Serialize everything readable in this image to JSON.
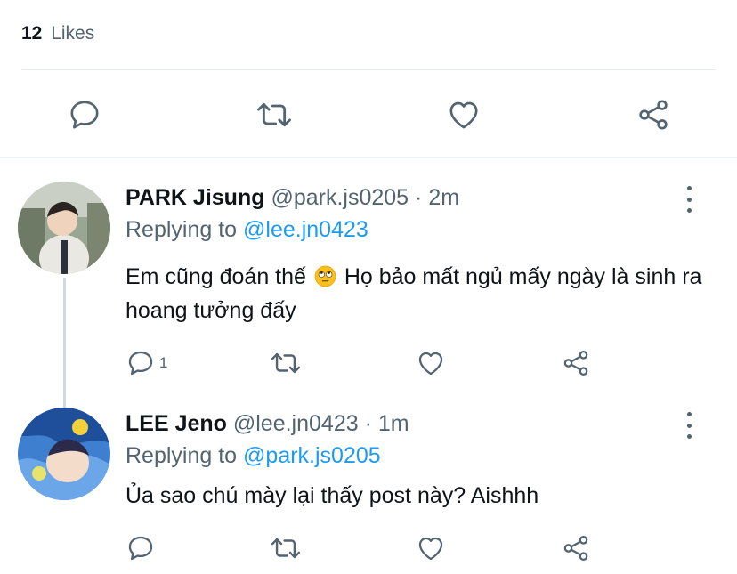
{
  "likes": {
    "count": "12",
    "label": "Likes"
  },
  "actions": {
    "reply_icon": "reply-icon",
    "retweet_icon": "retweet-icon",
    "like_icon": "heart-icon",
    "share_icon": "share-icon"
  },
  "replies": [
    {
      "name": "PARK Jisung",
      "handle": "@park.js0205",
      "dot": "·",
      "time": "2m",
      "replying_prefix": "Replying to",
      "replying_to": "@lee.jn0423",
      "text_before_emoji": "Em cũng đoán thế",
      "emoji": "rolling-eyes-emoji",
      "text_after_emoji": "Họ bảo mất ngủ mấy ngày là sinh ra hoang tưởng đấy",
      "reply_count": "1"
    },
    {
      "name": "LEE Jeno",
      "handle": "@lee.jn0423",
      "dot": "·",
      "time": "1m",
      "replying_prefix": "Replying to",
      "replying_to": "@park.js0205",
      "text": "Ủa sao chú mày lại thấy post này? Aishhh",
      "reply_count": ""
    }
  ],
  "colors": {
    "text": "#0f1419",
    "secondary": "#536471",
    "link": "#1d9bf0",
    "divider": "#e6ecf0"
  }
}
